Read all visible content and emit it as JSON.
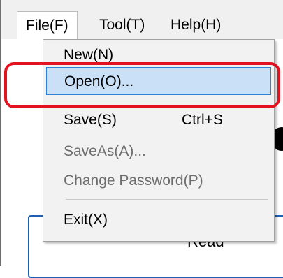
{
  "menubar": {
    "items": [
      {
        "label": "File(F)",
        "active": true
      },
      {
        "label": "Tool(T)",
        "active": false
      },
      {
        "label": "Help(H)",
        "active": false
      }
    ]
  },
  "file_menu": {
    "items": [
      {
        "label": "New(N)",
        "shortcut": "",
        "enabled": true,
        "highlighted": false
      },
      {
        "label": "Open(O)...",
        "shortcut": "",
        "enabled": true,
        "highlighted": true
      },
      {
        "label": "Save(S)",
        "shortcut": "Ctrl+S",
        "enabled": true,
        "highlighted": false
      },
      {
        "label": "SaveAs(A)...",
        "shortcut": "",
        "enabled": false,
        "highlighted": false
      },
      {
        "label": "Change Password(P)",
        "shortcut": "",
        "enabled": false,
        "highlighted": false
      },
      {
        "label": "Exit(X)",
        "shortcut": "",
        "enabled": true,
        "highlighted": false
      }
    ]
  },
  "background": {
    "read_button_label": "Read"
  },
  "colors": {
    "highlight_fill": "#c9e0f7",
    "highlight_border": "#2f7fd7",
    "callout_border": "#e2131e",
    "button_border": "#1e5fb0"
  }
}
